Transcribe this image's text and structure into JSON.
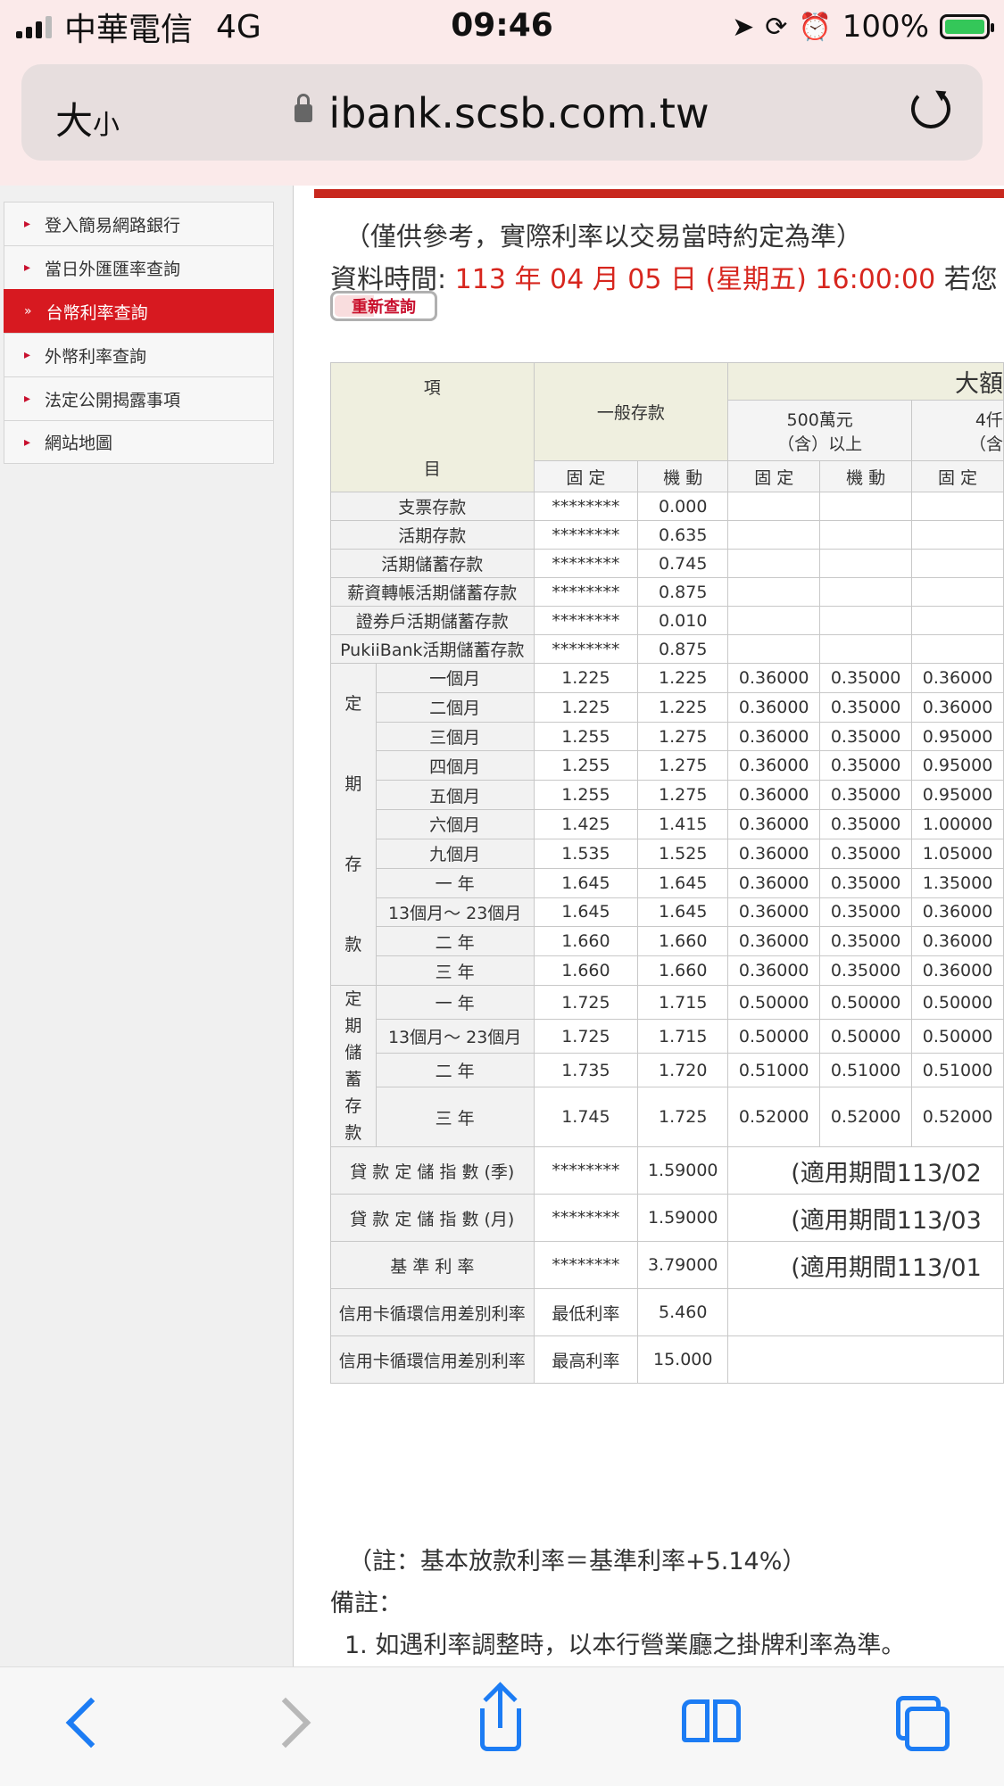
{
  "status_bar": {
    "carrier": "中華電信",
    "network": "4G",
    "time": "09:46",
    "battery": "100%"
  },
  "browser": {
    "text_size_label": "大",
    "text_size_small": "小",
    "url": "ibank.scsb.com.tw"
  },
  "sidebar": {
    "items": [
      {
        "label": "登入簡易網路銀行",
        "active": false
      },
      {
        "label": "當日外匯匯率查詢",
        "active": false
      },
      {
        "label": "台幣利率查詢",
        "active": true
      },
      {
        "label": "外幣利率查詢",
        "active": false
      },
      {
        "label": "法定公開揭露事項",
        "active": false
      },
      {
        "label": "網站地圖",
        "active": false
      }
    ]
  },
  "main": {
    "note": "（僅供參考，實際利率以交易當時約定為準）",
    "data_time_label": "資料時間:",
    "data_time_value": "113 年 04 月 05 日 (星期五) 16:00:00",
    "data_time_suffix": "若您",
    "requery_button": "重新查詢",
    "table": {
      "header": {
        "item_top": "項",
        "item_bottom": "目",
        "general": "一般存款",
        "large": "大額",
        "large_500": "500萬元",
        "large_500_sub": "（含）以上",
        "large_4": "4仟",
        "large_4_sub": "（含",
        "fixed": "固 定",
        "floating": "機 動"
      },
      "demand_rows": [
        {
          "label": "支票存款",
          "fixed": "********",
          "floating": "0.000"
        },
        {
          "label": "活期存款",
          "fixed": "********",
          "floating": "0.635"
        },
        {
          "label": "活期儲蓄存款",
          "fixed": "********",
          "floating": "0.745"
        },
        {
          "label": "薪資轉帳活期儲蓄存款",
          "fixed": "********",
          "floating": "0.875"
        },
        {
          "label": "證券戶活期儲蓄存款",
          "fixed": "********",
          "floating": "0.010"
        },
        {
          "label": "PukiiBank活期儲蓄存款",
          "fixed": "********",
          "floating": "0.875"
        }
      ],
      "time_deposit_label": [
        "定",
        "期",
        "存",
        "款"
      ],
      "time_deposit_rows": [
        {
          "term": "一個月",
          "fixed": "1.225",
          "floating": "1.225",
          "l500_fixed": "0.36000",
          "l500_floating": "0.35000",
          "l4_fixed": "0.36000"
        },
        {
          "term": "二個月",
          "fixed": "1.225",
          "floating": "1.225",
          "l500_fixed": "0.36000",
          "l500_floating": "0.35000",
          "l4_fixed": "0.36000"
        },
        {
          "term": "三個月",
          "fixed": "1.255",
          "floating": "1.275",
          "l500_fixed": "0.36000",
          "l500_floating": "0.35000",
          "l4_fixed": "0.95000"
        },
        {
          "term": "四個月",
          "fixed": "1.255",
          "floating": "1.275",
          "l500_fixed": "0.36000",
          "l500_floating": "0.35000",
          "l4_fixed": "0.95000"
        },
        {
          "term": "五個月",
          "fixed": "1.255",
          "floating": "1.275",
          "l500_fixed": "0.36000",
          "l500_floating": "0.35000",
          "l4_fixed": "0.95000"
        },
        {
          "term": "六個月",
          "fixed": "1.425",
          "floating": "1.415",
          "l500_fixed": "0.36000",
          "l500_floating": "0.35000",
          "l4_fixed": "1.00000"
        },
        {
          "term": "九個月",
          "fixed": "1.535",
          "floating": "1.525",
          "l500_fixed": "0.36000",
          "l500_floating": "0.35000",
          "l4_fixed": "1.05000"
        },
        {
          "term": "一 年",
          "fixed": "1.645",
          "floating": "1.645",
          "l500_fixed": "0.36000",
          "l500_floating": "0.35000",
          "l4_fixed": "1.35000"
        },
        {
          "term": "13個月～ 23個月",
          "fixed": "1.645",
          "floating": "1.645",
          "l500_fixed": "0.36000",
          "l500_floating": "0.35000",
          "l4_fixed": "0.36000"
        },
        {
          "term": "二 年",
          "fixed": "1.660",
          "floating": "1.660",
          "l500_fixed": "0.36000",
          "l500_floating": "0.35000",
          "l4_fixed": "0.36000"
        },
        {
          "term": "三 年",
          "fixed": "1.660",
          "floating": "1.660",
          "l500_fixed": "0.36000",
          "l500_floating": "0.35000",
          "l4_fixed": "0.36000"
        }
      ],
      "savings_label": [
        "定",
        "期",
        "儲",
        "蓄",
        "存",
        "款"
      ],
      "savings_rows": [
        {
          "term": "一 年",
          "fixed": "1.725",
          "floating": "1.715",
          "l500_fixed": "0.50000",
          "l500_floating": "0.50000",
          "l4_fixed": "0.50000"
        },
        {
          "term": "13個月～ 23個月",
          "fixed": "1.725",
          "floating": "1.715",
          "l500_fixed": "0.50000",
          "l500_floating": "0.50000",
          "l4_fixed": "0.50000"
        },
        {
          "term": "二 年",
          "fixed": "1.735",
          "floating": "1.720",
          "l500_fixed": "0.51000",
          "l500_floating": "0.51000",
          "l4_fixed": "0.51000"
        },
        {
          "term": "三 年",
          "fixed": "1.745",
          "floating": "1.725",
          "l500_fixed": "0.52000",
          "l500_floating": "0.52000",
          "l4_fixed": "0.52000"
        }
      ],
      "index_rows": [
        {
          "label": "貸 款 定 儲 指 數 (季)",
          "fixed": "********",
          "value": "1.59000",
          "note": "(適用期間113/02"
        },
        {
          "label": "貸 款 定 儲 指 數 (月)",
          "fixed": "********",
          "value": "1.59000",
          "note": "(適用期間113/03"
        },
        {
          "label": "基 準 利 率",
          "fixed": "********",
          "value": "3.79000",
          "note": "(適用期間113/01"
        }
      ],
      "card_rows": [
        {
          "label": "信用卡循環信用差別利率",
          "kind": "最低利率",
          "value": "5.460"
        },
        {
          "label": "信用卡循環信用差別利率",
          "kind": "最高利率",
          "value": "15.000"
        }
      ]
    },
    "footnote": "（註：基本放款利率＝基準利率+5.14%）",
    "remarks_title": "備註：",
    "remark_1": "1.  如遇利率調整時，以本行營業廳之掛牌利率為準。"
  }
}
